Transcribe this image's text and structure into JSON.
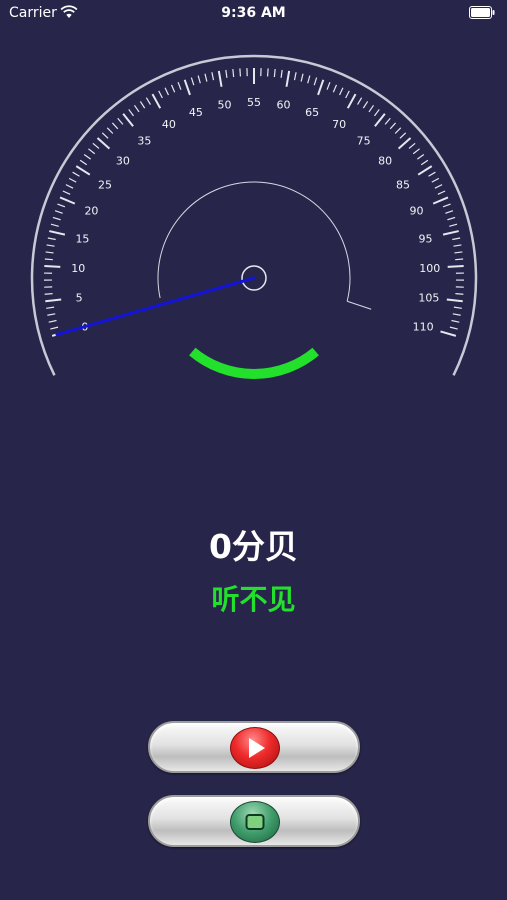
{
  "status_bar": {
    "carrier": "Carrier",
    "time": "9:36 AM",
    "icons": [
      "wifi-icon",
      "battery-icon"
    ]
  },
  "gauge": {
    "min": 0,
    "max": 110,
    "major_step": 5,
    "labels": [
      "0",
      "5",
      "10",
      "15",
      "20",
      "25",
      "30",
      "35",
      "40",
      "45",
      "50",
      "55",
      "60",
      "65",
      "70",
      "75",
      "80",
      "85",
      "90",
      "95",
      "100",
      "105",
      "110"
    ],
    "needle_value": 0,
    "needle_color": "#1414d8",
    "level_arc_color": "#22e02c"
  },
  "readout": {
    "value_text": "0分贝",
    "level_text": "听不见",
    "level_color": "#22e02c"
  },
  "controls": {
    "play_icon": "play-icon",
    "stop_icon": "stop-icon",
    "play_color": "#ef2b2b",
    "stop_color": "#3f9d6b"
  },
  "colors": {
    "background": "#27264a"
  }
}
